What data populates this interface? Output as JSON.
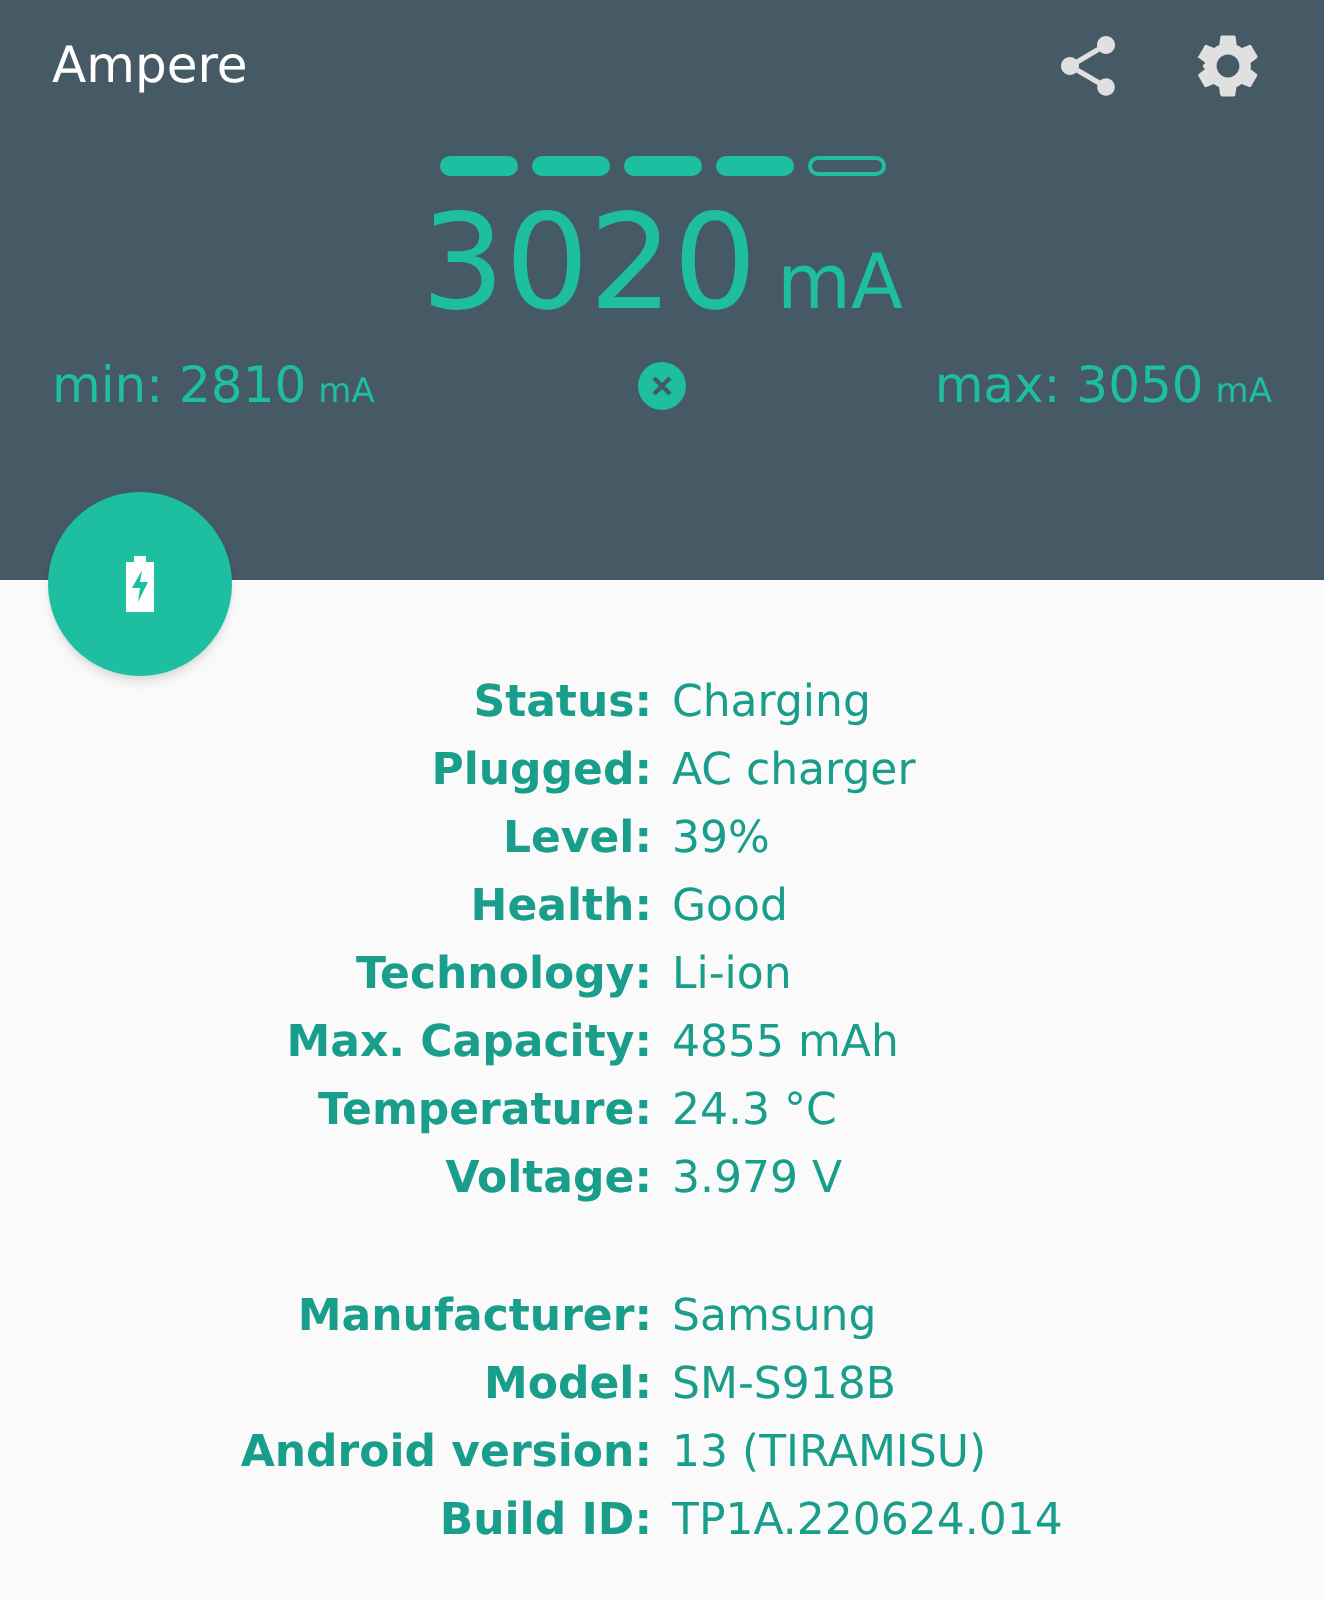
{
  "toolbar": {
    "title": "Ampere"
  },
  "meter": {
    "segments": [
      {
        "filled": true
      },
      {
        "filled": true
      },
      {
        "filled": true
      },
      {
        "filled": true
      },
      {
        "filled": false
      }
    ],
    "value": "3020",
    "unit": "mA",
    "min": {
      "label": "min:",
      "value": "2810",
      "unit": "mA"
    },
    "max": {
      "label": "max:",
      "value": "3050",
      "unit": "mA"
    }
  },
  "info_groups": [
    [
      {
        "label": "Status:",
        "value": "Charging"
      },
      {
        "label": "Plugged:",
        "value": "AC charger"
      },
      {
        "label": "Level:",
        "value": "39%"
      },
      {
        "label": "Health:",
        "value": "Good"
      },
      {
        "label": "Technology:",
        "value": "Li-ion"
      },
      {
        "label": "Max. Capacity:",
        "value": "4855 mAh"
      },
      {
        "label": "Temperature:",
        "value": "24.3 °C"
      },
      {
        "label": "Voltage:",
        "value": "3.979 V"
      }
    ],
    [
      {
        "label": "Manufacturer:",
        "value": "Samsung"
      },
      {
        "label": "Model:",
        "value": "SM-S918B"
      },
      {
        "label": "Android version:",
        "value": "13 (TIRAMISU)"
      },
      {
        "label": "Build ID:",
        "value": "TP1A.220624.014"
      }
    ]
  ]
}
